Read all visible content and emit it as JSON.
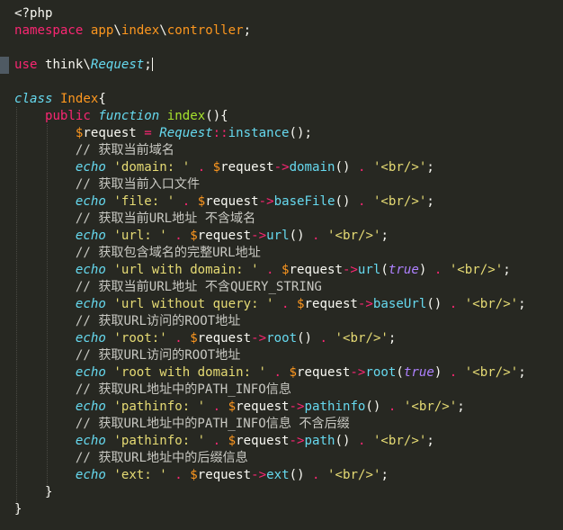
{
  "editor": {
    "theme_colors": {
      "background": "#272822",
      "keyword": "#f92672",
      "string": "#e6db74",
      "type": "#66d9ef",
      "classname": "#fd971f",
      "function": "#a6e22e",
      "constant": "#ae81ff",
      "foreground": "#f8f8f2"
    },
    "lines": [
      {
        "tokens": [
          {
            "t": "<?php",
            "c": "tag"
          }
        ]
      },
      {
        "tokens": [
          {
            "t": "namespace",
            "c": "kw"
          },
          {
            "t": " ",
            "c": "punc"
          },
          {
            "t": "app",
            "c": "ns"
          },
          {
            "t": "\\",
            "c": "punc"
          },
          {
            "t": "index",
            "c": "ns"
          },
          {
            "t": "\\",
            "c": "punc"
          },
          {
            "t": "controller",
            "c": "ns"
          },
          {
            "t": ";",
            "c": "punc"
          }
        ]
      },
      {
        "tokens": []
      },
      {
        "tokens": [
          {
            "t": "use",
            "c": "kw"
          },
          {
            "t": " think",
            "c": "ns2"
          },
          {
            "t": "\\",
            "c": "punc"
          },
          {
            "t": "Request",
            "c": "type"
          },
          {
            "t": ";",
            "c": "punc"
          }
        ],
        "cursor": true
      },
      {
        "tokens": []
      },
      {
        "tokens": [
          {
            "t": "class",
            "c": "type"
          },
          {
            "t": " ",
            "c": "punc"
          },
          {
            "t": "Index",
            "c": "class"
          },
          {
            "t": "{",
            "c": "punc"
          }
        ]
      },
      {
        "tokens": [
          {
            "t": "    ",
            "c": "punc"
          },
          {
            "t": "public",
            "c": "kw"
          },
          {
            "t": " ",
            "c": "punc"
          },
          {
            "t": "function",
            "c": "type"
          },
          {
            "t": " ",
            "c": "punc"
          },
          {
            "t": "index",
            "c": "fn"
          },
          {
            "t": "(){",
            "c": "punc"
          }
        ]
      },
      {
        "tokens": [
          {
            "t": "        ",
            "c": "punc"
          },
          {
            "t": "$",
            "c": "dollar"
          },
          {
            "t": "request",
            "c": "var"
          },
          {
            "t": " = ",
            "c": "op"
          },
          {
            "t": "Request",
            "c": "type"
          },
          {
            "t": "::",
            "c": "op"
          },
          {
            "t": "instance",
            "c": "method"
          },
          {
            "t": "();",
            "c": "punc"
          }
        ]
      },
      {
        "tokens": [
          {
            "t": "        // 获取当前域名",
            "c": "comment"
          }
        ]
      },
      {
        "tokens": [
          {
            "t": "        ",
            "c": "punc"
          },
          {
            "t": "echo",
            "c": "type"
          },
          {
            "t": " ",
            "c": "punc"
          },
          {
            "t": "'domain: '",
            "c": "str"
          },
          {
            "t": " . ",
            "c": "op"
          },
          {
            "t": "$",
            "c": "dollar"
          },
          {
            "t": "request",
            "c": "var"
          },
          {
            "t": "->",
            "c": "op"
          },
          {
            "t": "domain",
            "c": "method"
          },
          {
            "t": "()",
            "c": "punc"
          },
          {
            "t": " . ",
            "c": "op"
          },
          {
            "t": "'<br/>'",
            "c": "str"
          },
          {
            "t": ";",
            "c": "punc"
          }
        ]
      },
      {
        "tokens": [
          {
            "t": "        // 获取当前入口文件",
            "c": "comment"
          }
        ]
      },
      {
        "tokens": [
          {
            "t": "        ",
            "c": "punc"
          },
          {
            "t": "echo",
            "c": "type"
          },
          {
            "t": " ",
            "c": "punc"
          },
          {
            "t": "'file: '",
            "c": "str"
          },
          {
            "t": " . ",
            "c": "op"
          },
          {
            "t": "$",
            "c": "dollar"
          },
          {
            "t": "request",
            "c": "var"
          },
          {
            "t": "->",
            "c": "op"
          },
          {
            "t": "baseFile",
            "c": "method"
          },
          {
            "t": "()",
            "c": "punc"
          },
          {
            "t": " . ",
            "c": "op"
          },
          {
            "t": "'<br/>'",
            "c": "str"
          },
          {
            "t": ";",
            "c": "punc"
          }
        ]
      },
      {
        "tokens": [
          {
            "t": "        // 获取当前URL地址 不含域名",
            "c": "comment"
          }
        ]
      },
      {
        "tokens": [
          {
            "t": "        ",
            "c": "punc"
          },
          {
            "t": "echo",
            "c": "type"
          },
          {
            "t": " ",
            "c": "punc"
          },
          {
            "t": "'url: '",
            "c": "str"
          },
          {
            "t": " . ",
            "c": "op"
          },
          {
            "t": "$",
            "c": "dollar"
          },
          {
            "t": "request",
            "c": "var"
          },
          {
            "t": "->",
            "c": "op"
          },
          {
            "t": "url",
            "c": "method"
          },
          {
            "t": "()",
            "c": "punc"
          },
          {
            "t": " . ",
            "c": "op"
          },
          {
            "t": "'<br/>'",
            "c": "str"
          },
          {
            "t": ";",
            "c": "punc"
          }
        ]
      },
      {
        "tokens": [
          {
            "t": "        // 获取包含域名的完整URL地址",
            "c": "comment"
          }
        ]
      },
      {
        "tokens": [
          {
            "t": "        ",
            "c": "punc"
          },
          {
            "t": "echo",
            "c": "type"
          },
          {
            "t": " ",
            "c": "punc"
          },
          {
            "t": "'url with domain: '",
            "c": "str"
          },
          {
            "t": " . ",
            "c": "op"
          },
          {
            "t": "$",
            "c": "dollar"
          },
          {
            "t": "request",
            "c": "var"
          },
          {
            "t": "->",
            "c": "op"
          },
          {
            "t": "url",
            "c": "method"
          },
          {
            "t": "(",
            "c": "punc"
          },
          {
            "t": "true",
            "c": "bool"
          },
          {
            "t": ")",
            "c": "punc"
          },
          {
            "t": " . ",
            "c": "op"
          },
          {
            "t": "'<br/>'",
            "c": "str"
          },
          {
            "t": ";",
            "c": "punc"
          }
        ]
      },
      {
        "tokens": [
          {
            "t": "        // 获取当前URL地址 不含QUERY_STRING",
            "c": "comment"
          }
        ]
      },
      {
        "tokens": [
          {
            "t": "        ",
            "c": "punc"
          },
          {
            "t": "echo",
            "c": "type"
          },
          {
            "t": " ",
            "c": "punc"
          },
          {
            "t": "'url without query: '",
            "c": "str"
          },
          {
            "t": " . ",
            "c": "op"
          },
          {
            "t": "$",
            "c": "dollar"
          },
          {
            "t": "request",
            "c": "var"
          },
          {
            "t": "->",
            "c": "op"
          },
          {
            "t": "baseUrl",
            "c": "method"
          },
          {
            "t": "()",
            "c": "punc"
          },
          {
            "t": " . ",
            "c": "op"
          },
          {
            "t": "'<br/>'",
            "c": "str"
          },
          {
            "t": ";",
            "c": "punc"
          }
        ]
      },
      {
        "tokens": [
          {
            "t": "        // 获取URL访问的ROOT地址",
            "c": "comment"
          }
        ]
      },
      {
        "tokens": [
          {
            "t": "        ",
            "c": "punc"
          },
          {
            "t": "echo",
            "c": "type"
          },
          {
            "t": " ",
            "c": "punc"
          },
          {
            "t": "'root:'",
            "c": "str"
          },
          {
            "t": " . ",
            "c": "op"
          },
          {
            "t": "$",
            "c": "dollar"
          },
          {
            "t": "request",
            "c": "var"
          },
          {
            "t": "->",
            "c": "op"
          },
          {
            "t": "root",
            "c": "method"
          },
          {
            "t": "()",
            "c": "punc"
          },
          {
            "t": " . ",
            "c": "op"
          },
          {
            "t": "'<br/>'",
            "c": "str"
          },
          {
            "t": ";",
            "c": "punc"
          }
        ]
      },
      {
        "tokens": [
          {
            "t": "        // 获取URL访问的ROOT地址",
            "c": "comment"
          }
        ]
      },
      {
        "tokens": [
          {
            "t": "        ",
            "c": "punc"
          },
          {
            "t": "echo",
            "c": "type"
          },
          {
            "t": " ",
            "c": "punc"
          },
          {
            "t": "'root with domain: '",
            "c": "str"
          },
          {
            "t": " . ",
            "c": "op"
          },
          {
            "t": "$",
            "c": "dollar"
          },
          {
            "t": "request",
            "c": "var"
          },
          {
            "t": "->",
            "c": "op"
          },
          {
            "t": "root",
            "c": "method"
          },
          {
            "t": "(",
            "c": "punc"
          },
          {
            "t": "true",
            "c": "bool"
          },
          {
            "t": ")",
            "c": "punc"
          },
          {
            "t": " . ",
            "c": "op"
          },
          {
            "t": "'<br/>'",
            "c": "str"
          },
          {
            "t": ";",
            "c": "punc"
          }
        ]
      },
      {
        "tokens": [
          {
            "t": "        // 获取URL地址中的PATH_INFO信息",
            "c": "comment"
          }
        ]
      },
      {
        "tokens": [
          {
            "t": "        ",
            "c": "punc"
          },
          {
            "t": "echo",
            "c": "type"
          },
          {
            "t": " ",
            "c": "punc"
          },
          {
            "t": "'pathinfo: '",
            "c": "str"
          },
          {
            "t": " . ",
            "c": "op"
          },
          {
            "t": "$",
            "c": "dollar"
          },
          {
            "t": "request",
            "c": "var"
          },
          {
            "t": "->",
            "c": "op"
          },
          {
            "t": "pathinfo",
            "c": "method"
          },
          {
            "t": "()",
            "c": "punc"
          },
          {
            "t": " . ",
            "c": "op"
          },
          {
            "t": "'<br/>'",
            "c": "str"
          },
          {
            "t": ";",
            "c": "punc"
          }
        ]
      },
      {
        "tokens": [
          {
            "t": "        // 获取URL地址中的PATH_INFO信息 不含后缀",
            "c": "comment"
          }
        ]
      },
      {
        "tokens": [
          {
            "t": "        ",
            "c": "punc"
          },
          {
            "t": "echo",
            "c": "type"
          },
          {
            "t": " ",
            "c": "punc"
          },
          {
            "t": "'pathinfo: '",
            "c": "str"
          },
          {
            "t": " . ",
            "c": "op"
          },
          {
            "t": "$",
            "c": "dollar"
          },
          {
            "t": "request",
            "c": "var"
          },
          {
            "t": "->",
            "c": "op"
          },
          {
            "t": "path",
            "c": "method"
          },
          {
            "t": "()",
            "c": "punc"
          },
          {
            "t": " . ",
            "c": "op"
          },
          {
            "t": "'<br/>'",
            "c": "str"
          },
          {
            "t": ";",
            "c": "punc"
          }
        ]
      },
      {
        "tokens": [
          {
            "t": "        // 获取URL地址中的后缀信息",
            "c": "comment"
          }
        ]
      },
      {
        "tokens": [
          {
            "t": "        ",
            "c": "punc"
          },
          {
            "t": "echo",
            "c": "type"
          },
          {
            "t": " ",
            "c": "punc"
          },
          {
            "t": "'ext: '",
            "c": "str"
          },
          {
            "t": " . ",
            "c": "op"
          },
          {
            "t": "$",
            "c": "dollar"
          },
          {
            "t": "request",
            "c": "var"
          },
          {
            "t": "->",
            "c": "op"
          },
          {
            "t": "ext",
            "c": "method"
          },
          {
            "t": "()",
            "c": "punc"
          },
          {
            "t": " . ",
            "c": "op"
          },
          {
            "t": "'<br/>'",
            "c": "str"
          },
          {
            "t": ";",
            "c": "punc"
          }
        ]
      },
      {
        "tokens": [
          {
            "t": "    }",
            "c": "punc"
          }
        ]
      },
      {
        "tokens": [
          {
            "t": "}",
            "c": "punc"
          }
        ]
      }
    ]
  }
}
